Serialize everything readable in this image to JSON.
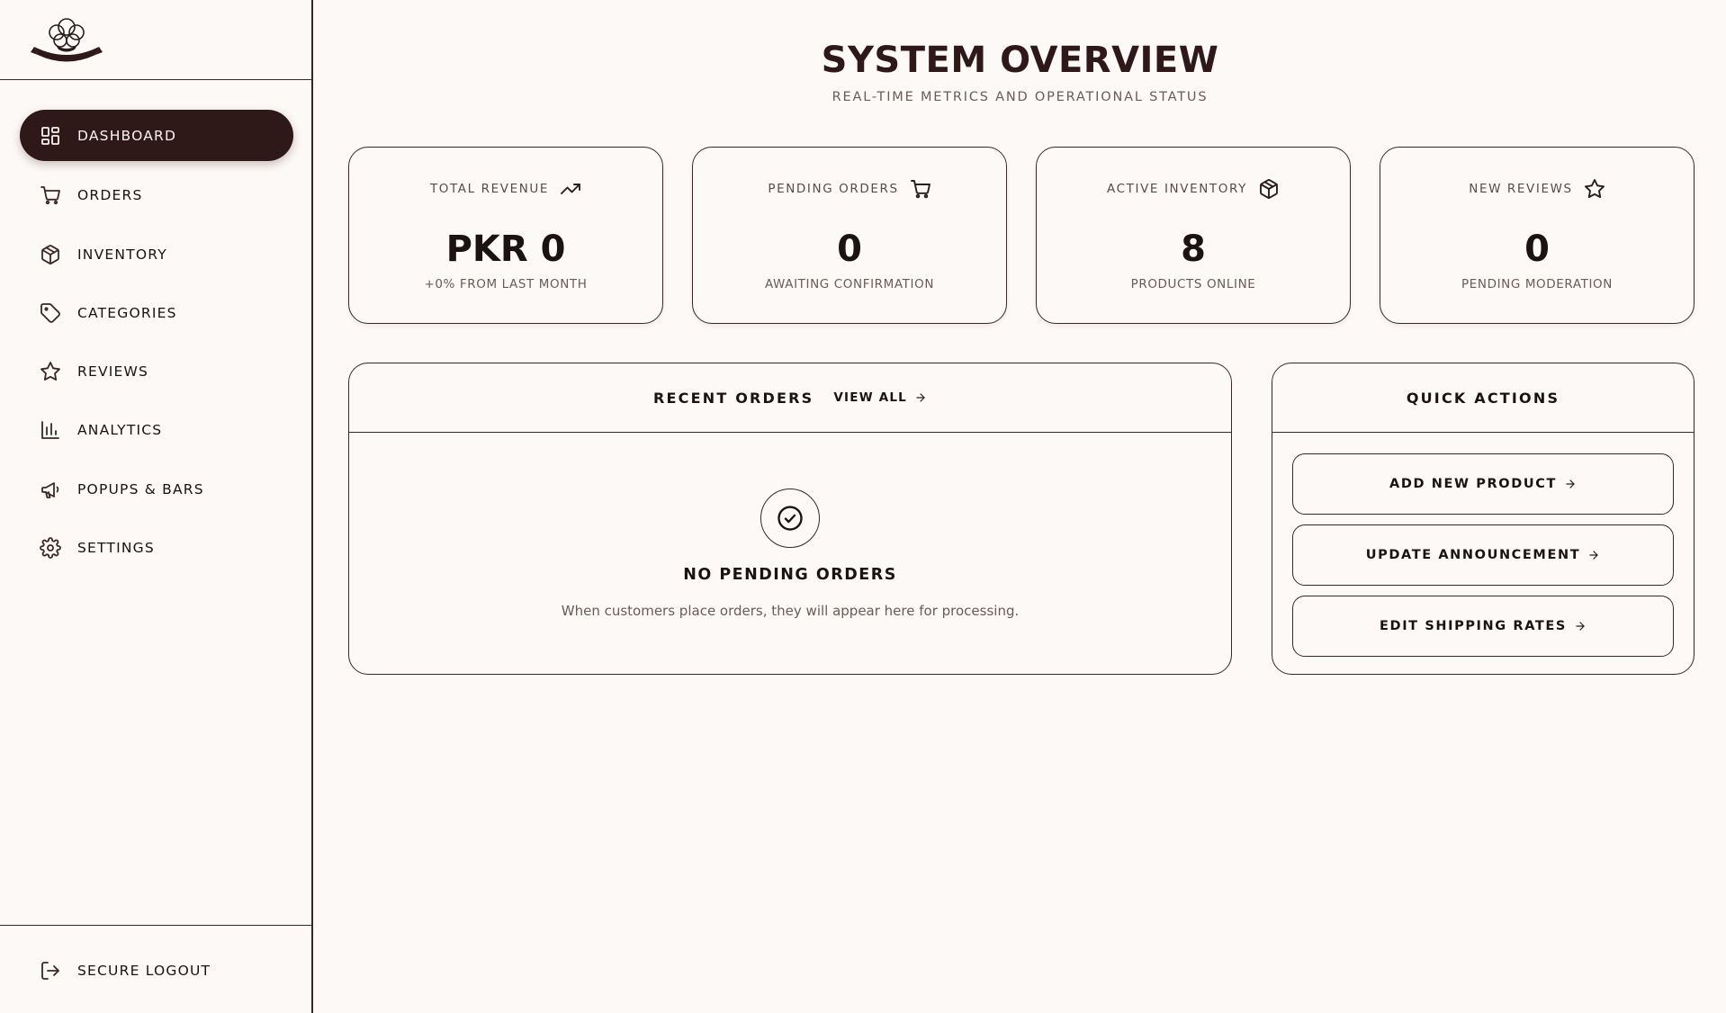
{
  "sidebar": {
    "logo_icon": "cotton-flower-logo",
    "nav": [
      {
        "label": "DASHBOARD",
        "icon": "grid-icon",
        "active": true
      },
      {
        "label": "ORDERS",
        "icon": "cart-icon"
      },
      {
        "label": "INVENTORY",
        "icon": "box-icon"
      },
      {
        "label": "CATEGORIES",
        "icon": "tag-icon"
      },
      {
        "label": "REVIEWS",
        "icon": "star-icon"
      },
      {
        "label": "ANALYTICS",
        "icon": "bar-chart-icon"
      },
      {
        "label": "POPUPS & BARS",
        "icon": "megaphone-icon"
      },
      {
        "label": "SETTINGS",
        "icon": "gear-icon"
      }
    ],
    "logout_label": "SECURE LOGOUT"
  },
  "header": {
    "title": "SYSTEM OVERVIEW",
    "subtitle": "REAL-TIME METRICS AND OPERATIONAL STATUS"
  },
  "stats": [
    {
      "label": "TOTAL REVENUE",
      "icon": "trending-up-icon",
      "value": "PKR 0",
      "sub": "+0% FROM LAST MONTH"
    },
    {
      "label": "PENDING ORDERS",
      "icon": "cart-icon",
      "value": "0",
      "sub": "AWAITING CONFIRMATION"
    },
    {
      "label": "ACTIVE INVENTORY",
      "icon": "box-icon",
      "value": "8",
      "sub": "PRODUCTS ONLINE"
    },
    {
      "label": "NEW REVIEWS",
      "icon": "star-icon",
      "value": "0",
      "sub": "PENDING MODERATION"
    }
  ],
  "recent_orders": {
    "title": "RECENT ORDERS",
    "view_all": "VIEW ALL",
    "empty_title": "NO PENDING ORDERS",
    "empty_text": "When customers place orders, they will appear here for processing."
  },
  "quick_actions": {
    "title": "QUICK ACTIONS",
    "buttons": [
      "ADD NEW PRODUCT",
      "UPDATE ANNOUNCEMENT",
      "EDIT SHIPPING RATES"
    ]
  },
  "colors": {
    "background": "#fdf9f7",
    "accent": "#2f1818",
    "border": "#3a2626"
  }
}
